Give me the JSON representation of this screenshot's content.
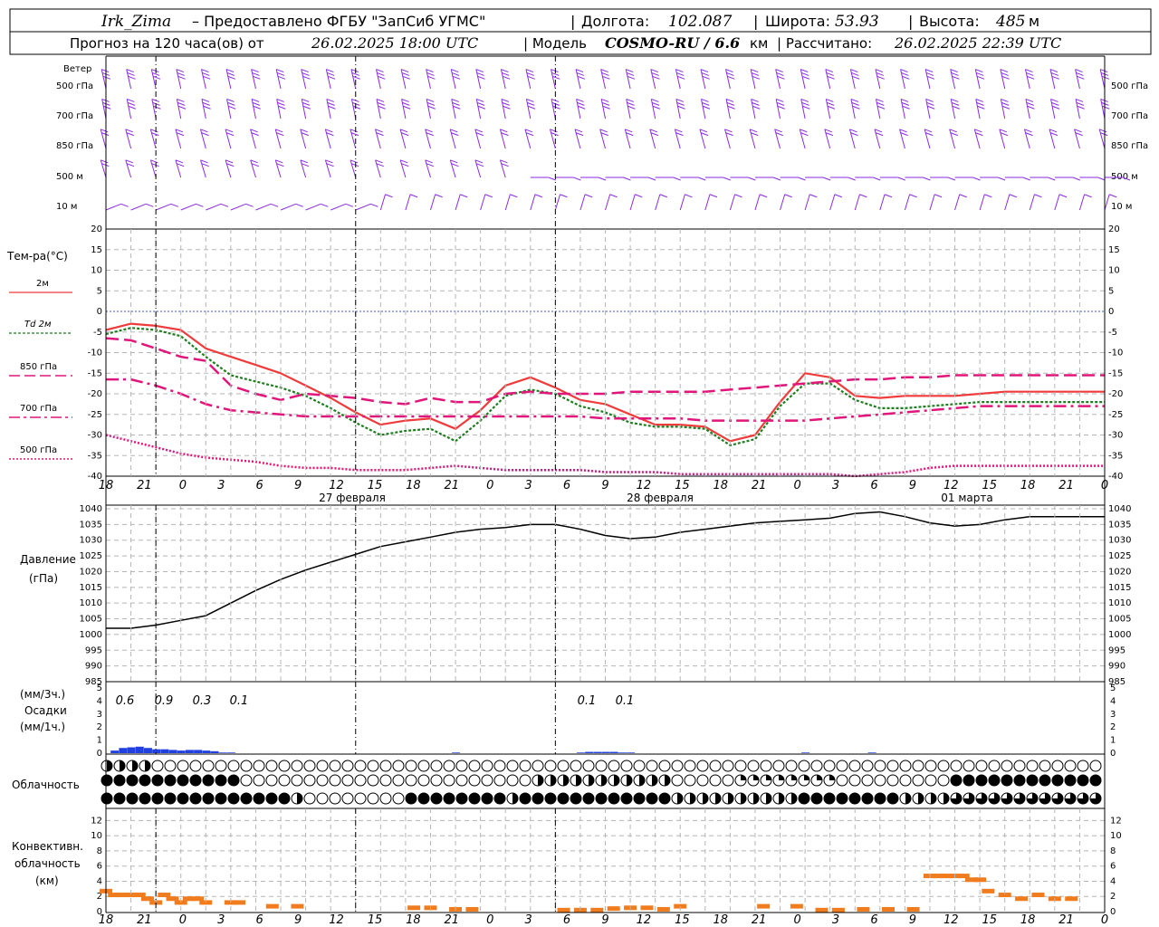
{
  "header": {
    "station": "Irk_Zima",
    "provider": " – Предоставлено ФГБУ \"ЗапСиб УГМС\"",
    "lon_label": "Долгота:",
    "lon": "102.087",
    "lat_label": "Широта:",
    "lat": "53.93",
    "alt_label": "Высота:",
    "alt": "485",
    "alt_unit": "м",
    "forecast_prefix": "Прогноз на 120 часа(ов) от",
    "forecast_start": "26.02.2025 18:00 UTC",
    "model_prefix": "| Модель",
    "model_name": "COSMO-RU / 6.6",
    "model_unit": "км",
    "calc_prefix": "| Рассчитано:",
    "calc_time": "26.02.2025 22:39 UTC"
  },
  "wind_panel": {
    "title": "Ветер",
    "levels": [
      "500 гПа",
      "700 гПа",
      "850 гПа",
      "500 м",
      "10  м"
    ],
    "levels_right": [
      "500 гПа",
      "700 гПа",
      "850 гПа",
      "500 м",
      "10 м"
    ]
  },
  "temp_panel": {
    "title": "Тем-ра(°С)",
    "legend": [
      "2м",
      "Td 2м",
      "850 гПа",
      "700 гПа",
      "500 гПа"
    ],
    "legend_colors": [
      "#ef3b3b",
      "#1e7d1e",
      "#e0167a",
      "#e0167a",
      "#e0167a"
    ]
  },
  "pressure_panel": {
    "title": "Давление",
    "unit": "(гПа)"
  },
  "precip_panel": {
    "unit3": "(мм/3ч.)",
    "title": "Осадки",
    "unit1": "(мм/1ч.)",
    "labels": [
      "0.6",
      "0.9",
      "0.3",
      "0.1",
      "0.1",
      "0.1"
    ]
  },
  "cloud_panel": {
    "title": "Облачность"
  },
  "conv_panel": {
    "title1": "Конвективн.",
    "title2": "облачность",
    "unit": "(км)"
  },
  "time_axis": {
    "hours": [
      "18",
      "21",
      "0",
      "3",
      "6",
      "9",
      "12",
      "15",
      "18",
      "21",
      "0",
      "3",
      "6",
      "9",
      "12",
      "15",
      "18",
      "21",
      "0",
      "3",
      "6",
      "9",
      "12",
      "15",
      "18",
      "21",
      "0"
    ],
    "dates": [
      "27 февраля",
      "28 февраля",
      "01 марта"
    ]
  },
  "colors": {
    "wind": "#8a2be2",
    "t2m": "#ef3b3b",
    "td": "#1e7d1e",
    "t850": "#e0167a",
    "pressure": "#000000",
    "precip": "#2040e0",
    "conv": "#f07c1e"
  },
  "chart_data": [
    {
      "type": "line",
      "title": "Тем-ра(°С)",
      "x_hours": [
        0,
        3,
        6,
        9,
        12,
        15,
        18,
        21,
        24,
        27,
        30,
        33,
        36,
        39,
        42,
        45,
        48,
        51,
        54,
        57,
        60,
        63,
        66,
        69,
        72,
        75,
        78,
        81,
        84,
        87,
        90,
        93,
        96,
        99,
        102,
        105,
        108,
        111,
        114,
        117,
        120
      ],
      "ylim": [
        -40,
        20
      ],
      "series": [
        {
          "name": "2м",
          "values": [
            -4.5,
            -3,
            -3.5,
            -4.5,
            -9,
            -11,
            -13,
            -15,
            -18,
            -21,
            -24.5,
            -27.5,
            -26.5,
            -26,
            -28.5,
            -24,
            -18,
            -16,
            -18.5,
            -21.5,
            -22.5,
            -25,
            -27.5,
            -27.5,
            -28,
            -31.5,
            -30,
            -22,
            -15,
            -16,
            -20.5,
            -21,
            -20.5,
            -20.5,
            -20.5,
            -20,
            -19.5,
            -19.5,
            -19.5,
            -19.5,
            -19.5
          ]
        },
        {
          "name": "Td 2м",
          "values": [
            -5.5,
            -4,
            -4.5,
            -6,
            -11,
            -15.5,
            -17,
            -18.5,
            -20.5,
            -23.5,
            -27,
            -30,
            -29,
            -28.5,
            -31.5,
            -26.5,
            -20.5,
            -19,
            -20,
            -23,
            -24.5,
            -27,
            -28,
            -28,
            -28.5,
            -32.5,
            -31,
            -23,
            -17.5,
            -17.5,
            -21.5,
            -23.5,
            -23.5,
            -23,
            -22.5,
            -22,
            -22,
            -22,
            -22,
            -22,
            -22
          ]
        },
        {
          "name": "850 гПа",
          "values": [
            -6.5,
            -7,
            -9,
            -11,
            -12,
            -18,
            -20,
            -21.5,
            -20,
            -20.5,
            -21,
            -22,
            -22.5,
            -21,
            -22,
            -22,
            -20,
            -19.5,
            -20,
            -20,
            -20,
            -19.5,
            -19.5,
            -19.5,
            -19.5,
            -19,
            -18.5,
            -18,
            -17.5,
            -17,
            -16.5,
            -16.5,
            -16,
            -16,
            -15.5,
            -15.5,
            -15.5,
            -15.5,
            -15.5,
            -15.5,
            -15.5
          ]
        },
        {
          "name": "700 гПа",
          "values": [
            -16.5,
            -16.5,
            -18,
            -20,
            -22.5,
            -24,
            -24.5,
            -25,
            -25.5,
            -25.5,
            -25.5,
            -25.5,
            -25.5,
            -25.5,
            -25.5,
            -25.5,
            -25.5,
            -25.5,
            -25.5,
            -25.5,
            -26,
            -26,
            -26,
            -26,
            -26.5,
            -26.5,
            -26.5,
            -26.5,
            -26.5,
            -26,
            -25.5,
            -25,
            -24.5,
            -24,
            -23.5,
            -23,
            -23,
            -23,
            -23,
            -23,
            -23
          ]
        },
        {
          "name": "500 гПа",
          "values": [
            -30,
            -31.5,
            -33,
            -34.5,
            -35.5,
            -36,
            -36.5,
            -37.5,
            -38,
            -38,
            -38.5,
            -38.5,
            -38.5,
            -38,
            -37.5,
            -38,
            -38.5,
            -38.5,
            -38.5,
            -38.5,
            -39,
            -39,
            -39,
            -39.5,
            -39.5,
            -39.5,
            -39.5,
            -39.5,
            -39.5,
            -39.5,
            -40,
            -39.5,
            -39,
            -38,
            -37.5,
            -37.5,
            -37.5,
            -37.5,
            -37.5,
            -37.5,
            -37.5
          ]
        }
      ]
    },
    {
      "type": "line",
      "title": "Давление",
      "x_hours": [
        0,
        3,
        6,
        9,
        12,
        15,
        18,
        21,
        24,
        27,
        30,
        33,
        36,
        39,
        42,
        45,
        48,
        51,
        54,
        57,
        60,
        63,
        66,
        69,
        72,
        75,
        78,
        81,
        84,
        87,
        90,
        93,
        96,
        99,
        102,
        105,
        108,
        111,
        114,
        117,
        120
      ],
      "ylim": [
        985,
        1040
      ],
      "series": [
        {
          "name": "Давление",
          "values": [
            1002,
            1002,
            1003,
            1004.5,
            1006,
            1010,
            1014,
            1017.5,
            1020.5,
            1023,
            1025.5,
            1028,
            1029.5,
            1031,
            1032.5,
            1033.5,
            1034,
            1035,
            1035,
            1033.5,
            1031.5,
            1030.5,
            1031,
            1032.5,
            1033.5,
            1034.5,
            1035.5,
            1036,
            1036.5,
            1037,
            1038.5,
            1039,
            1037.5,
            1035.5,
            1034.5,
            1035,
            1036.5,
            1037.5,
            1037.5,
            1037.5,
            1037.5
          ]
        }
      ]
    },
    {
      "type": "bar",
      "title": "Осадки",
      "x_hours": [
        1,
        2,
        3,
        4,
        5,
        6,
        7,
        8,
        9,
        10,
        11,
        12,
        13,
        14,
        15,
        42,
        57,
        58,
        59,
        60,
        61,
        62,
        63,
        84,
        92
      ],
      "ylim": [
        0,
        5
      ],
      "values": [
        0.2,
        0.4,
        0.45,
        0.5,
        0.4,
        0.3,
        0.3,
        0.25,
        0.2,
        0.25,
        0.25,
        0.2,
        0.15,
        0.05,
        0.05,
        0.05,
        0.05,
        0.1,
        0.1,
        0.1,
        0.1,
        0.05,
        0.05,
        0.05,
        0.05
      ]
    },
    {
      "type": "bar",
      "title": "Конвективн. облачность",
      "x_hours": [
        0,
        1,
        2,
        3,
        4,
        5,
        6,
        7,
        8,
        9,
        10,
        11,
        12,
        15,
        16,
        20,
        23,
        37,
        39,
        42,
        44,
        55,
        57,
        59,
        61,
        63,
        65,
        67,
        69,
        79,
        83,
        86,
        88,
        91,
        94,
        97,
        99,
        100,
        101,
        102,
        103,
        104,
        105,
        106,
        108,
        110,
        112,
        114,
        116
      ],
      "ylim": [
        0,
        13
      ],
      "values": [
        3,
        2.5,
        2.5,
        2.5,
        2.5,
        2,
        1.5,
        2.5,
        2,
        1.5,
        2,
        2,
        1.5,
        1.5,
        1.5,
        1,
        1,
        0.8,
        0.8,
        0.6,
        0.6,
        0.5,
        0.5,
        0.5,
        0.7,
        0.8,
        0.8,
        0.6,
        1,
        1,
        1,
        0.5,
        0.5,
        0.6,
        0.6,
        0.6,
        5,
        5,
        5,
        5,
        5,
        4.5,
        4.5,
        3,
        2.5,
        2,
        2.5,
        2,
        2
      ]
    }
  ]
}
